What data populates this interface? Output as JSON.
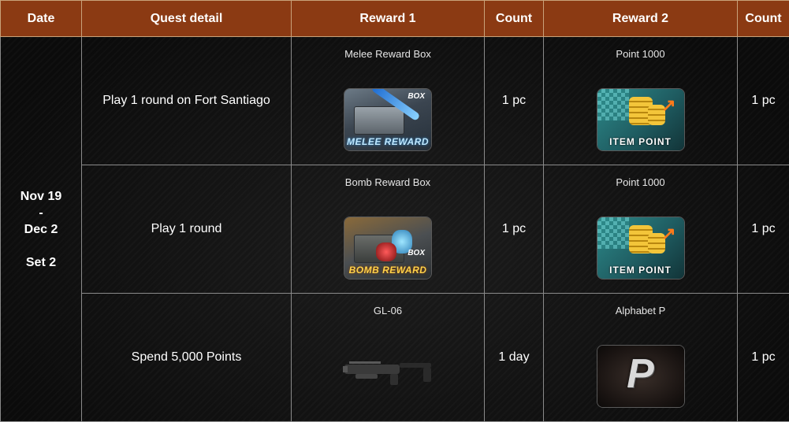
{
  "headers": {
    "date": "Date",
    "quest_detail": "Quest detail",
    "reward1": "Reward 1",
    "count1": "Count",
    "reward2": "Reward 2",
    "count2": "Count"
  },
  "date": {
    "line1": "Nov 19",
    "line2": "-",
    "line3": "Dec 2",
    "line4": "Set 2"
  },
  "rows": [
    {
      "quest": "Play 1 round on Fort Santiago",
      "reward1": {
        "name": "Melee Reward Box",
        "icon": "melee-reward-box-icon",
        "tag": "BOX",
        "title": "MELEE REWARD"
      },
      "count1": "1 pc",
      "reward2": {
        "name": "Point 1000",
        "icon": "item-point-icon",
        "title": "ITEM POINT"
      },
      "count2": "1 pc"
    },
    {
      "quest": "Play 1 round",
      "reward1": {
        "name": "Bomb Reward Box",
        "icon": "bomb-reward-box-icon",
        "tag": "BOX",
        "title": "BOMB REWARD"
      },
      "count1": "1 pc",
      "reward2": {
        "name": "Point 1000",
        "icon": "item-point-icon",
        "title": "ITEM POINT"
      },
      "count2": "1 pc"
    },
    {
      "quest": "Spend 5,000 Points",
      "reward1": {
        "name": "GL-06",
        "icon": "grenade-launcher-icon"
      },
      "count1": "1 day",
      "reward2": {
        "name": "Alphabet P",
        "icon": "alphabet-p-icon",
        "letter": "P"
      },
      "count2": "1 pc"
    }
  ],
  "colors": {
    "header_bg": "#8b3a13",
    "table_bg": "#0d0d0d",
    "border": "#8a8a8a"
  }
}
